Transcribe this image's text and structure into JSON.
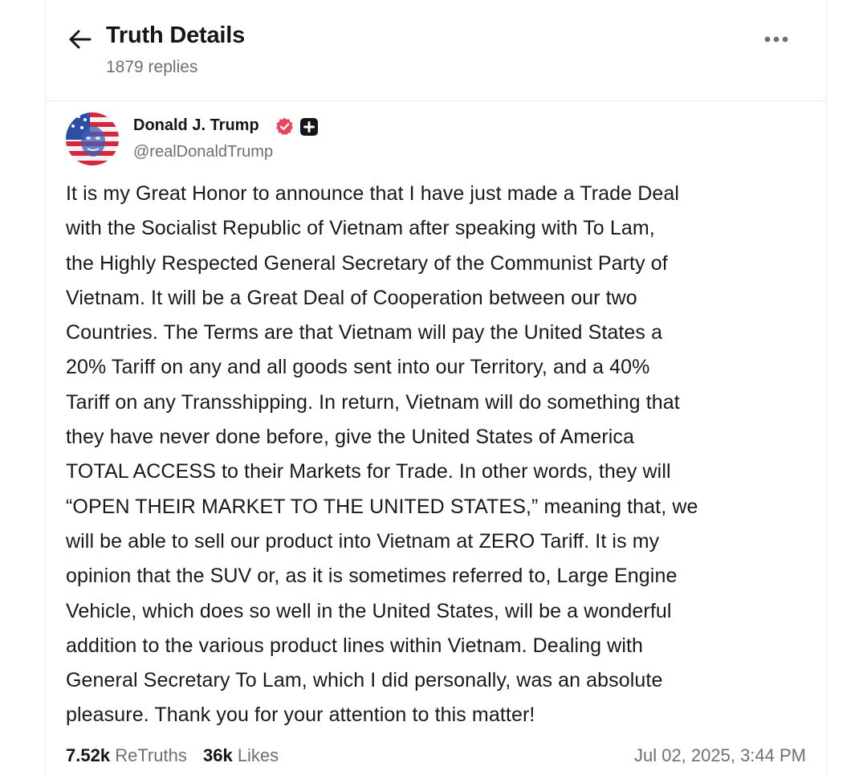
{
  "header": {
    "back_icon": "arrow-left-icon",
    "title": "Truth Details",
    "reply_count": "1879 replies",
    "more_icon": "more-horizontal-icon"
  },
  "post": {
    "author": {
      "name": "Donald J. Trump",
      "handle": "@realDonaldTrump",
      "verified_icon": "verified-badge-icon",
      "plus_icon": "plus-badge-icon",
      "verified_color": "#e8455b"
    },
    "body": "It is my Great Honor to announce that I have just made a Trade Deal\nwith the Socialist Republic of Vietnam after speaking with To Lam,\nthe Highly Respected General Secretary of the Communist Party of\nVietnam. It will be a Great Deal of Cooperation between our two\nCountries. The Terms are that Vietnam will pay the United States a\n20% Tariff on any and all goods sent into our Territory, and a 40%\nTariff on any Transshipping. In return, Vietnam will do something that\nthey have never done before, give the United States of America\nTOTAL ACCESS to their Markets for Trade. In other words, they will\n“OPEN THEIR MARKET TO THE UNITED STATES,” meaning that, we\nwill be able to sell our product into Vietnam at ZERO Tariff. It is my\nopinion that the SUV or, as it is sometimes referred to, Large Engine\nVehicle, which does so well in the United States, will be a wonderful\naddition to the various product lines within Vietnam. Dealing with\nGeneral Secretary To Lam, which I did personally, was an absolute\npleasure. Thank you for your attention to this matter!",
    "retruths_count": "7.52k",
    "retruths_label": "ReTruths",
    "likes_count": "36k",
    "likes_label": "Likes",
    "timestamp": "Jul 02, 2025, 3:44 PM"
  }
}
